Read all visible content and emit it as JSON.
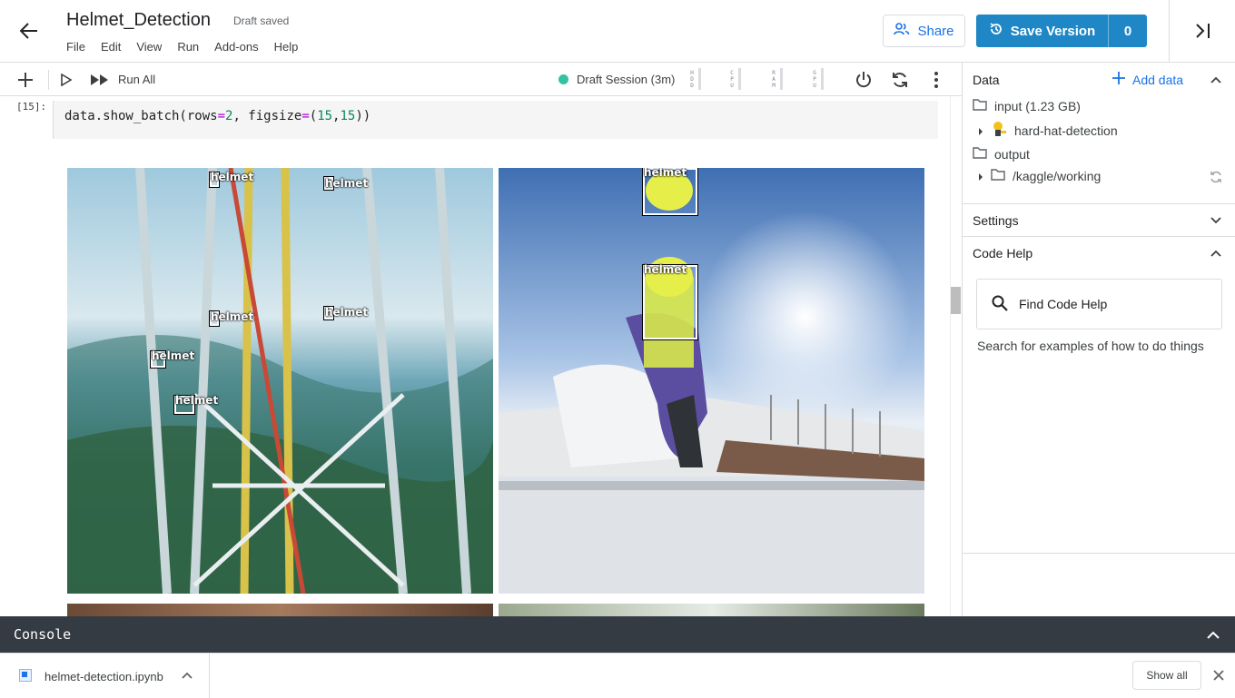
{
  "header": {
    "title": "Helmet_Detection",
    "status": "Draft saved",
    "menu": [
      "File",
      "Edit",
      "View",
      "Run",
      "Add-ons",
      "Help"
    ],
    "share_label": "Share",
    "save_label": "Save Version",
    "version_count": "0"
  },
  "toolbar": {
    "run_all_label": "Run All",
    "session_label": "Draft Session (3m)",
    "session_color": "#34c3a0",
    "meters": [
      {
        "label": "HDD"
      },
      {
        "label": "CPU"
      },
      {
        "label": "RAM"
      },
      {
        "label": "GPU"
      }
    ]
  },
  "cell": {
    "prompt": "[15]:",
    "code_prefix": "data.show_batch(rows",
    "code_eq1": "=",
    "code_num1": "2",
    "code_mid": ",  figsize",
    "code_eq2": "=",
    "code_open": "(",
    "code_num2": "15",
    "code_comma": ",",
    "code_num3": "15",
    "code_close": "))"
  },
  "output": {
    "left_labels": [
      "helmet",
      "helmet",
      "helmet",
      "helmet",
      "helmet",
      "helmet"
    ],
    "right_labels": [
      "helmet",
      "helmet"
    ]
  },
  "right_panel": {
    "data_title": "Data",
    "add_data_label": "Add data",
    "input_label": "input (1.23 GB)",
    "dataset_label": "hard-hat-detection",
    "output_label": "output",
    "working_label": "/kaggle/working",
    "settings_title": "Settings",
    "code_help_title": "Code Help",
    "find_placeholder": "Find Code Help",
    "find_hint": "Search for examples of how to do things"
  },
  "console": {
    "title": "Console"
  },
  "downloads": {
    "file_name": "helmet-detection.ipynb",
    "show_all_label": "Show all"
  },
  "colors": {
    "accent": "#1f87c5",
    "link": "#1a73e8",
    "console_bg": "#353b43"
  }
}
